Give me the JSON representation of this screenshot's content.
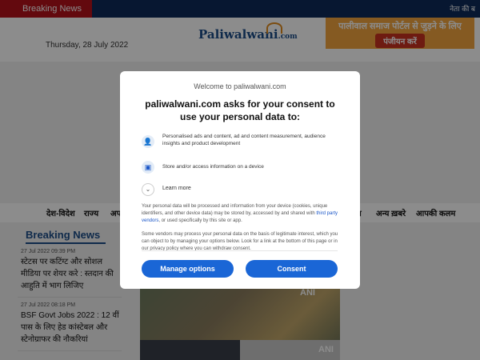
{
  "topbar": {
    "breaking_label": "Breaking News",
    "ticker_text": "नेता की ब"
  },
  "header": {
    "date": "Thursday, 28 July 2022",
    "logo": "Paliwalwani",
    "logo_suffix": ".com",
    "ad": {
      "line1": "पालीवाल समाज पोर्टल से जुड़ने के लिए",
      "button": "पंजीयन करें"
    }
  },
  "nav": {
    "items": [
      "देश-विदेश",
      "राज्य",
      "अप",
      "अन्य ख़बरे",
      "आपकी कलम",
      "स"
    ]
  },
  "breaking_news": {
    "title": "Breaking News",
    "items": [
      {
        "time": "27 Jul 2022 09:39 PM",
        "headline": "स्टेटस पर कटिंग्ट और सोशल मीडिया पर शेयर करे : स्तदान की आहुति में भाग लिजिए"
      },
      {
        "time": "27 Jul 2022 08:18 PM",
        "headline": "BSF Govt Jobs 2022 : 12 वीं पास के लिए हेड कांस्टेबल और स्टेनोग्राफर की नौकरियां"
      }
    ]
  },
  "photo": {
    "watermark": "ANI"
  },
  "consent": {
    "welcome": "Welcome to paliwalwani.com",
    "title": "paliwalwani.com asks for your consent to use your personal data to:",
    "purposes": [
      {
        "icon": "person-icon",
        "text": "Personalised ads and content, ad and content measurement, audience insights and product development"
      },
      {
        "icon": "device-icon",
        "text": "Store and/or access information on a device"
      }
    ],
    "learn_more": "Learn more",
    "para1_before": "Your personal data will be processed and information from your device (cookies, unique identifiers, and other device data) may be stored by, accessed by and shared with ",
    "para1_link": "third party vendors",
    "para1_after": ", or used specifically by this site or app.",
    "para2": "Some vendors may process your personal data on the basis of legitimate interest, which you can object to by managing your options below. Look for a link at the bottom of this page or in our privacy policy where you can withdraw consent.",
    "manage_label": "Manage options",
    "consent_label": "Consent",
    "accent": "#1a66d6"
  }
}
